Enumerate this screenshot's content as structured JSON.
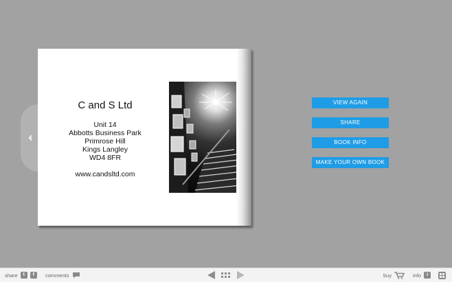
{
  "book": {
    "company": "C and S Ltd",
    "address_lines": [
      "Unit 14",
      "Abbotts Business Park",
      "Primrose Hill",
      "Kings Langley",
      "WD4 8FR"
    ],
    "website": "www.candsltd.com"
  },
  "menu": {
    "view_again": "VIEW AGAIN",
    "share": "SHARE",
    "book_info": "BOOK INFO",
    "make_own": "MAKE YOUR OWN BOOK"
  },
  "footer": {
    "share_label": "share",
    "twitter_letter": "t",
    "facebook_letter": "f",
    "comments_label": "comments",
    "buy_label": "buy",
    "info_label": "info",
    "info_letter": "i"
  },
  "colors": {
    "background": "#a2a2a2",
    "button": "#1f9ce6",
    "footer": "#f3f3f3"
  }
}
